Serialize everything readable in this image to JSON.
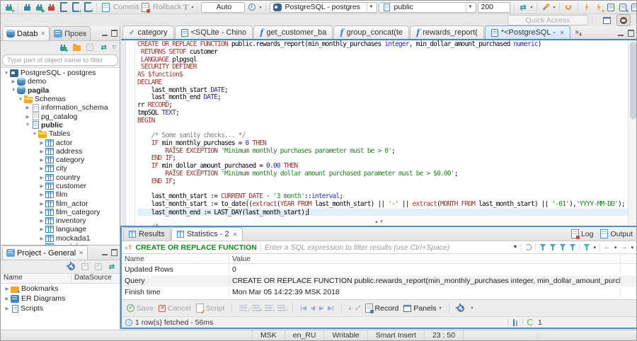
{
  "main_toolbar": {
    "commit_label": "Commit",
    "rollback_label": "Rollback",
    "txn_mode_label": "Auto",
    "connection_value": "PostgreSQL - postgres",
    "schema_value": "public",
    "fetch_size_value": "200",
    "quick_access_placeholder": "Quick Access"
  },
  "navigator": {
    "tab_database": "Datab",
    "tab_projects": "Проек",
    "filter_placeholder": "Type part of object name to filter",
    "tree": [
      {
        "level": 0,
        "expanded": true,
        "icon": "postgres-db",
        "label": "PostgreSQL - postgres",
        "bold": false
      },
      {
        "level": 1,
        "expanded": false,
        "icon": "database",
        "label": "demo",
        "bold": false
      },
      {
        "level": 1,
        "expanded": true,
        "icon": "database",
        "label": "pagila",
        "bold": true
      },
      {
        "level": 2,
        "expanded": true,
        "icon": "folder",
        "label": "Schemas",
        "bold": false
      },
      {
        "level": 3,
        "expanded": false,
        "icon": "schema-system",
        "label": "information_schema",
        "bold": false
      },
      {
        "level": 3,
        "expanded": false,
        "icon": "schema-system",
        "label": "pg_catalog",
        "bold": false
      },
      {
        "level": 3,
        "expanded": true,
        "icon": "schema",
        "label": "public",
        "bold": true
      },
      {
        "level": 4,
        "expanded": true,
        "icon": "folder",
        "label": "Tables",
        "bold": false
      },
      {
        "level": 5,
        "expanded": false,
        "icon": "table",
        "label": "actor",
        "bold": false
      },
      {
        "level": 5,
        "expanded": false,
        "icon": "table",
        "label": "address",
        "bold": false
      },
      {
        "level": 5,
        "expanded": false,
        "icon": "table",
        "label": "category",
        "bold": false
      },
      {
        "level": 5,
        "expanded": false,
        "icon": "table",
        "label": "city",
        "bold": false
      },
      {
        "level": 5,
        "expanded": false,
        "icon": "table",
        "label": "country",
        "bold": false
      },
      {
        "level": 5,
        "expanded": false,
        "icon": "table",
        "label": "customer",
        "bold": false
      },
      {
        "level": 5,
        "expanded": false,
        "icon": "table",
        "label": "film",
        "bold": false
      },
      {
        "level": 5,
        "expanded": false,
        "icon": "table",
        "label": "film_actor",
        "bold": false
      },
      {
        "level": 5,
        "expanded": false,
        "icon": "table",
        "label": "film_category",
        "bold": false
      },
      {
        "level": 5,
        "expanded": false,
        "icon": "table",
        "label": "inventory",
        "bold": false
      },
      {
        "level": 5,
        "expanded": false,
        "icon": "table",
        "label": "language",
        "bold": false
      },
      {
        "level": 5,
        "expanded": false,
        "icon": "table",
        "label": "mockada1",
        "bold": false
      },
      {
        "level": 5,
        "expanded": false,
        "icon": "table",
        "label": "mockdata",
        "bold": false
      }
    ]
  },
  "project_panel": {
    "title": "Project - General",
    "columns": [
      "Name",
      "DataSource"
    ],
    "items": [
      {
        "icon": "bookmarks-folder",
        "label": "Bookmarks"
      },
      {
        "icon": "er-diagrams",
        "label": "ER Diagrams"
      },
      {
        "icon": "scripts-folder",
        "label": "Scripts"
      }
    ]
  },
  "editor": {
    "tabs": [
      {
        "icon": "check",
        "label": "category",
        "active": false,
        "closable": false
      },
      {
        "icon": "sql",
        "label": "<SQLite - Chino",
        "active": false,
        "closable": false
      },
      {
        "icon": "func",
        "label": "get_customer_ba",
        "active": false,
        "closable": false
      },
      {
        "icon": "func",
        "label": "group_concat(te",
        "active": false,
        "closable": false
      },
      {
        "icon": "func",
        "label": "rewards_report(",
        "active": false,
        "closable": false
      },
      {
        "icon": "sql",
        "label": "*<PostgreSQL - ",
        "active": true,
        "closable": true
      }
    ],
    "hidden_tabs_count": "4",
    "code_lines": [
      {
        "tokens": [
          [
            "k",
            "CREATE OR REPLACE FUNCTION"
          ],
          [
            "p",
            " public.rewards_report(min_monthly_purchases "
          ],
          [
            "t",
            "integer"
          ],
          [
            "p",
            ", min_dollar_amount_purchased "
          ],
          [
            "t",
            "numeric"
          ],
          [
            "p",
            ")"
          ]
        ]
      },
      {
        "tokens": [
          [
            "p",
            " "
          ],
          [
            "k",
            "RETURNS SETOF"
          ],
          [
            "p",
            " customer"
          ]
        ]
      },
      {
        "tokens": [
          [
            "p",
            " "
          ],
          [
            "k",
            "LANGUAGE"
          ],
          [
            "p",
            " plpgsql"
          ]
        ]
      },
      {
        "tokens": [
          [
            "p",
            " "
          ],
          [
            "k",
            "SECURITY DEFINER"
          ]
        ]
      },
      {
        "tokens": [
          [
            "k",
            "AS"
          ],
          [
            "p",
            " "
          ],
          [
            "k",
            "$function$"
          ]
        ]
      },
      {
        "tokens": [
          [
            "k",
            "DECLARE"
          ]
        ]
      },
      {
        "tokens": [
          [
            "p",
            "    last_month_start "
          ],
          [
            "t",
            "DATE"
          ],
          [
            "p",
            ";"
          ]
        ]
      },
      {
        "tokens": [
          [
            "p",
            "    last_month_end "
          ],
          [
            "t",
            "DATE"
          ],
          [
            "p",
            ";"
          ]
        ]
      },
      {
        "tokens": [
          [
            "p",
            "rr "
          ],
          [
            "k",
            "RECORD"
          ],
          [
            "p",
            ";"
          ]
        ]
      },
      {
        "tokens": [
          [
            "p",
            "tmpSQL "
          ],
          [
            "t",
            "TEXT"
          ],
          [
            "p",
            ";"
          ]
        ]
      },
      {
        "tokens": [
          [
            "k",
            "BEGIN"
          ]
        ]
      },
      {
        "tokens": []
      },
      {
        "tokens": [
          [
            "c",
            "    /* Some sanity checks... */"
          ]
        ]
      },
      {
        "tokens": [
          [
            "p",
            "    "
          ],
          [
            "k",
            "IF"
          ],
          [
            "p",
            " min_monthly_purchases = "
          ],
          [
            "n",
            "0"
          ],
          [
            "p",
            " "
          ],
          [
            "k",
            "THEN"
          ]
        ]
      },
      {
        "tokens": [
          [
            "p",
            "        "
          ],
          [
            "k",
            "RAISE EXCEPTION"
          ],
          [
            "p",
            " "
          ],
          [
            "s",
            "'Minimum monthly purchases parameter must be > 0'"
          ],
          [
            "p",
            ";"
          ]
        ]
      },
      {
        "tokens": [
          [
            "p",
            "    "
          ],
          [
            "k",
            "END IF"
          ],
          [
            "p",
            ";"
          ]
        ]
      },
      {
        "tokens": [
          [
            "p",
            "    "
          ],
          [
            "k",
            "IF"
          ],
          [
            "p",
            " min_dollar_amount_purchased = "
          ],
          [
            "n",
            "0.00"
          ],
          [
            "p",
            " "
          ],
          [
            "k",
            "THEN"
          ]
        ]
      },
      {
        "tokens": [
          [
            "p",
            "        "
          ],
          [
            "k",
            "RAISE EXCEPTION"
          ],
          [
            "p",
            " "
          ],
          [
            "s",
            "'Minimum monthly dollar amount purchased parameter must be > $0.00'"
          ],
          [
            "p",
            ";"
          ]
        ]
      },
      {
        "tokens": [
          [
            "p",
            "    "
          ],
          [
            "k",
            "END IF"
          ],
          [
            "p",
            ";"
          ]
        ]
      },
      {
        "tokens": []
      },
      {
        "tokens": [
          [
            "p",
            "    last_month_start := "
          ],
          [
            "k",
            "CURRENT_DATE"
          ],
          [
            "p",
            " - "
          ],
          [
            "s",
            "'3 month'"
          ],
          [
            "p",
            "::"
          ],
          [
            "t",
            "interval"
          ],
          [
            "p",
            ";"
          ]
        ]
      },
      {
        "tokens": [
          [
            "p",
            "    last_month_start := to_date(("
          ],
          [
            "k",
            "extract"
          ],
          [
            "p",
            "("
          ],
          [
            "k",
            "YEAR FROM"
          ],
          [
            "p",
            " last_month_start) || "
          ],
          [
            "s",
            "'-'"
          ],
          [
            "p",
            " || "
          ],
          [
            "k",
            "extract"
          ],
          [
            "p",
            "("
          ],
          [
            "k",
            "MONTH FROM"
          ],
          [
            "p",
            " last_month_start) || "
          ],
          [
            "s",
            "'-01'"
          ],
          [
            "p",
            "),"
          ],
          [
            "s",
            "'YYYY-MM-DD'"
          ],
          [
            "p",
            ");"
          ]
        ]
      },
      {
        "current": true,
        "tokens": [
          [
            "p",
            "    last_month_end := LAST_DAY(last_month_start);"
          ]
        ]
      },
      {
        "tokens": []
      },
      {
        "tokens": [
          [
            "c",
            "    /*"
          ]
        ]
      }
    ]
  },
  "results_panel": {
    "tab_results": "Results",
    "tab_statistics": "Statistics - 2",
    "log_label": "Log",
    "output_label": "Output",
    "filter_text": "CREATE OR REPLACE FUNCTION",
    "filter_placeholder": "Enter a SQL expression to filter results (use Ctrl+Space)",
    "table": {
      "columns": [
        "Name",
        "Value"
      ],
      "rows": [
        [
          "Updated Rows",
          "0"
        ],
        [
          "Query",
          "CREATE OR REPLACE FUNCTION public.rewards_report(min_monthly_purchases integer, min_dollar_amount_purcha..."
        ],
        [
          "Finish time",
          "Mon Mar 05 14:22:39 MSK 2018"
        ]
      ]
    },
    "toolbar": {
      "save_label": "Save",
      "cancel_label": "Cancel",
      "script_label": "Script",
      "record_label": "Record",
      "panels_label": "Panels"
    },
    "status_text": "1 row(s) fetched - 56ms",
    "exec_count": "1"
  },
  "status_bar": {
    "items": [
      "MSK",
      "en_RU",
      "Writable",
      "Smart Insert",
      "23 : 50"
    ]
  }
}
